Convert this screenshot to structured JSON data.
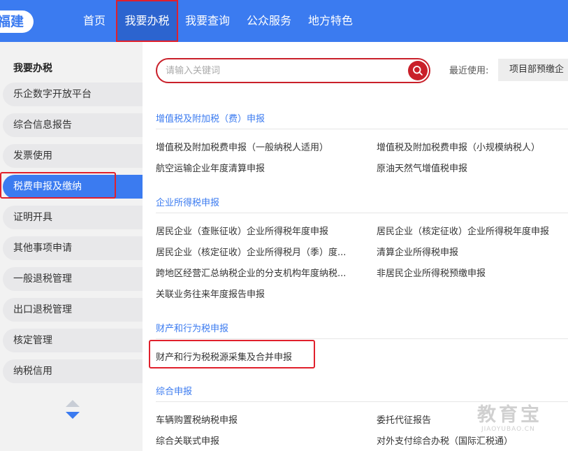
{
  "brand": {
    "text": "福建"
  },
  "nav": {
    "items": [
      {
        "label": "首页"
      },
      {
        "label": "我要办税"
      },
      {
        "label": "我要查询"
      },
      {
        "label": "公众服务"
      },
      {
        "label": "地方特色"
      }
    ]
  },
  "sidebar": {
    "title": "我要办税",
    "items": [
      {
        "label": "乐企数字开放平台"
      },
      {
        "label": "综合信息报告"
      },
      {
        "label": "发票使用"
      },
      {
        "label": "税费申报及缴纳"
      },
      {
        "label": "证明开具"
      },
      {
        "label": "其他事项申请"
      },
      {
        "label": "一般退税管理"
      },
      {
        "label": "出口退税管理"
      },
      {
        "label": "核定管理"
      },
      {
        "label": "纳税信用"
      }
    ]
  },
  "search": {
    "placeholder": "请输入关键词",
    "value": ""
  },
  "recent": {
    "label": "最近使用:",
    "item": "项目部预缴企"
  },
  "sections": [
    {
      "title": "增值税及附加税（费）申报",
      "links": [
        "增值税及附加税费申报（一般纳税人适用）",
        "增值税及附加税费申报（小规模纳税人）",
        "航空运输企业年度清算申报",
        "原油天然气增值税申报"
      ]
    },
    {
      "title": "企业所得税申报",
      "links": [
        "居民企业（查账征收）企业所得税年度申报",
        "居民企业（核定征收）企业所得税年度申报",
        "居民企业（核定征收）企业所得税月（季）度...",
        "清算企业所得税申报",
        "跨地区经营汇总纳税企业的分支机构年度纳税...",
        "非居民企业所得税预缴申报",
        "关联业务往来年度报告申报"
      ]
    },
    {
      "title": "财产和行为税申报",
      "links": [
        "财产和行为税税源采集及合并申报"
      ]
    },
    {
      "title": "综合申报",
      "links": [
        "车辆购置税纳税申报",
        "委托代征报告",
        "综合关联式申报",
        "对外支付综合办税（国际汇税通）"
      ]
    }
  ],
  "watermark": {
    "main": "教育宝",
    "sub": "JIAOYUBAO.CN"
  },
  "colors": {
    "primary": "#3b7bf0",
    "highlight": "#e0202c",
    "search_red": "#c9202a"
  }
}
